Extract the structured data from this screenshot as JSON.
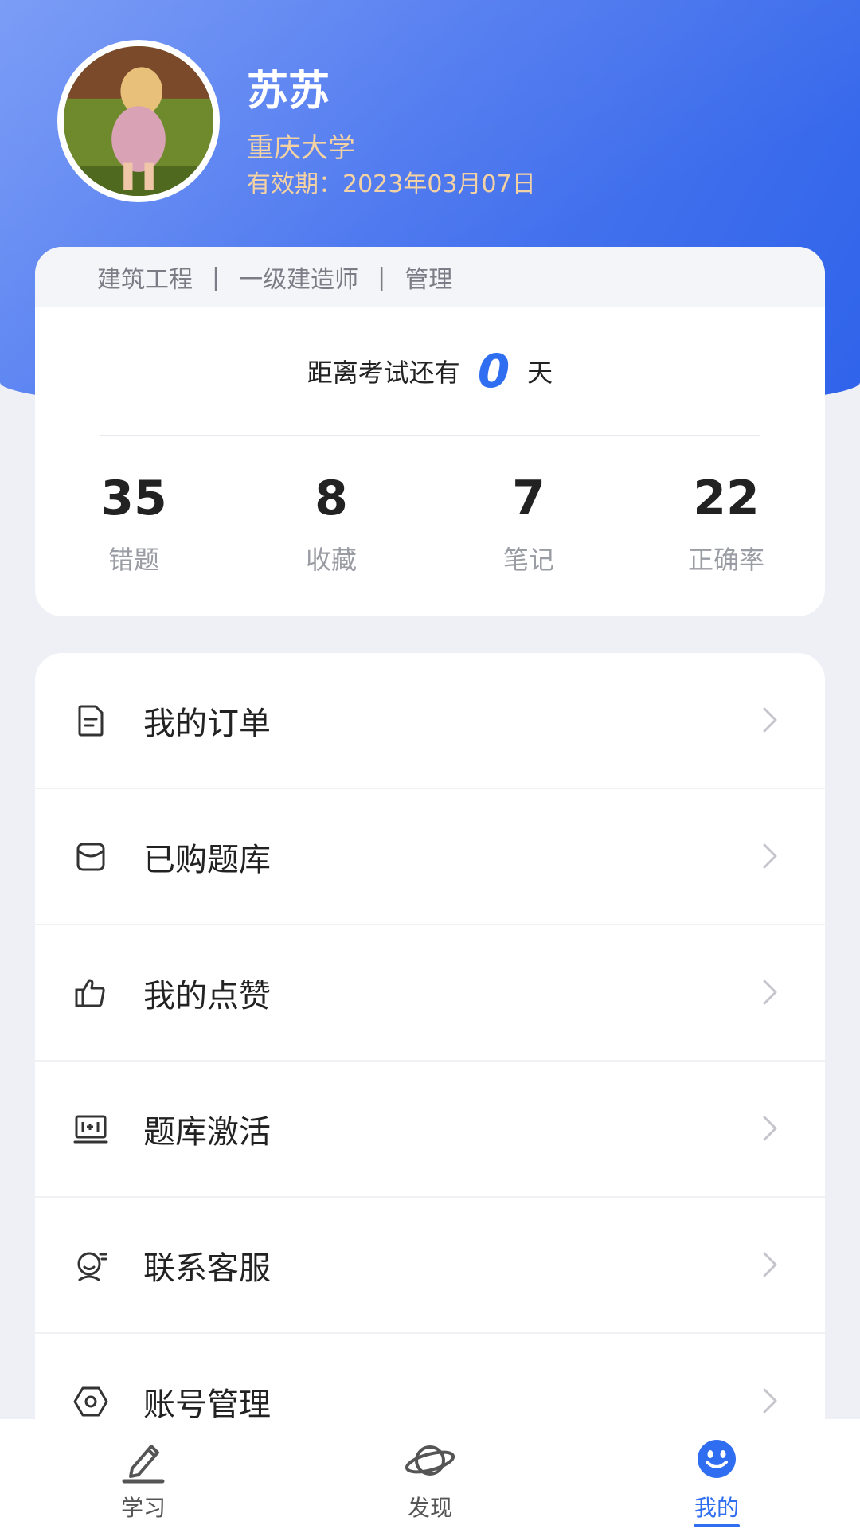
{
  "profile": {
    "name": "苏苏",
    "organization": "重庆大学",
    "expiry": "有效期：2023年03月07日"
  },
  "tags": [
    "建筑工程",
    "一级建造师",
    "管理"
  ],
  "tag_separator": "|",
  "countdown": {
    "prefix": "距离考试还有",
    "days": "0",
    "suffix": "天"
  },
  "stats": [
    {
      "value": "35",
      "label": "错题"
    },
    {
      "value": "8",
      "label": "收藏"
    },
    {
      "value": "7",
      "label": "笔记"
    },
    {
      "value": "22",
      "label": "正确率"
    }
  ],
  "menu": [
    {
      "label": "我的订单",
      "icon": "order-icon"
    },
    {
      "label": "已购题库",
      "icon": "bag-icon"
    },
    {
      "label": "我的点赞",
      "icon": "thumbs-up-icon"
    },
    {
      "label": "题库激活",
      "icon": "activate-icon"
    },
    {
      "label": "联系客服",
      "icon": "customer-service-icon"
    },
    {
      "label": "账号管理",
      "icon": "settings-icon"
    }
  ],
  "tabs": [
    {
      "label": "学习",
      "icon": "pencil-icon",
      "active": false
    },
    {
      "label": "发现",
      "icon": "planet-icon",
      "active": false
    },
    {
      "label": "我的",
      "icon": "smiley-icon",
      "active": true
    }
  ],
  "colors": {
    "accent": "#2f6ef0",
    "header_start": "#6d92f5",
    "header_end": "#2f63ea",
    "gold": "#f4d2a3"
  }
}
